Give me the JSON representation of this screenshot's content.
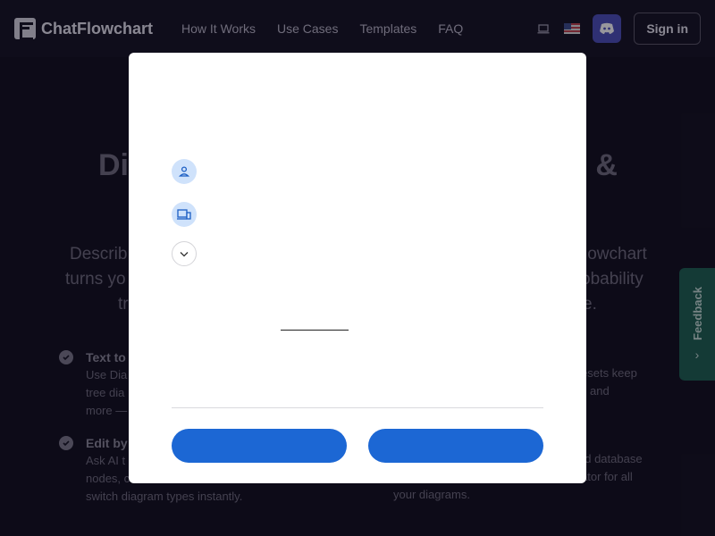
{
  "brand": {
    "name": "ChatFlowchart"
  },
  "nav": {
    "links": [
      "How It Works",
      "Use Cases",
      "Templates",
      "FAQ"
    ],
    "theme_icon": "laptop-icon",
    "language_icon": "us-flag-icon",
    "discord_icon": "discord-icon",
    "signin_label": "Sign in"
  },
  "hero": {
    "title_left": "Di",
    "title_right": "s &",
    "desc_lines": [
      {
        "left": "Describ",
        "right": "lowchart"
      },
      {
        "left": "turns yo",
        "right": "obability"
      },
      {
        "left": "tr",
        "right": "e."
      }
    ]
  },
  "features": [
    {
      "title": "Text to",
      "lines": [
        "Use Dia",
        "tree dia",
        "more —"
      ]
    },
    {
      "title": "",
      "lines": [
        "esets keep",
        "and",
        ""
      ]
    },
    {
      "title": "Edit by",
      "lines": [
        "Ask AI t",
        "nodes, c",
        "switch diagram types instantly."
      ]
    },
    {
      "title": "",
      "lines": [
        "nd database",
        "ator for all",
        "your diagrams."
      ]
    }
  ],
  "feedback": {
    "label": "Feedback"
  },
  "modal": {
    "options": [
      {
        "icon": "user-icon"
      },
      {
        "icon": "devices-icon"
      },
      {
        "icon": "chevron-down-icon"
      }
    ],
    "primary_label": "",
    "secondary_label": ""
  },
  "colors": {
    "page_bg": "#110f1d",
    "modal_bg": "#ffffff",
    "accent_blue": "#1c67d4",
    "icon_bg": "#cfe2fb",
    "feedback_green": "#1c5f50"
  }
}
